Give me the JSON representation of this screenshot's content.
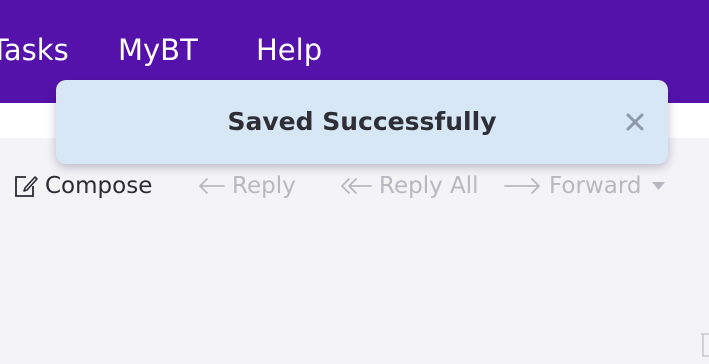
{
  "nav": {
    "items": [
      {
        "label": "Tasks"
      },
      {
        "label": "MyBT"
      },
      {
        "label": "Help"
      }
    ]
  },
  "toast": {
    "message": "Saved Successfully",
    "close_icon": "close-icon",
    "background": "#d7e7f5"
  },
  "toolbar": {
    "compose": {
      "label": "Compose",
      "icon": "compose-icon"
    },
    "reply": {
      "label": "Reply",
      "icon": "reply-arrow-icon"
    },
    "reply_all": {
      "label": "Reply All",
      "icon": "reply-all-arrow-icon"
    },
    "forward": {
      "label": "Forward",
      "icon": "forward-arrow-icon",
      "dropdown_icon": "chevron-down-icon"
    }
  },
  "colors": {
    "header": "#5512ab",
    "toolbar_background": "#f4f4f6",
    "text_active": "#2b2b35",
    "text_disabled": "#b8b8c0"
  }
}
